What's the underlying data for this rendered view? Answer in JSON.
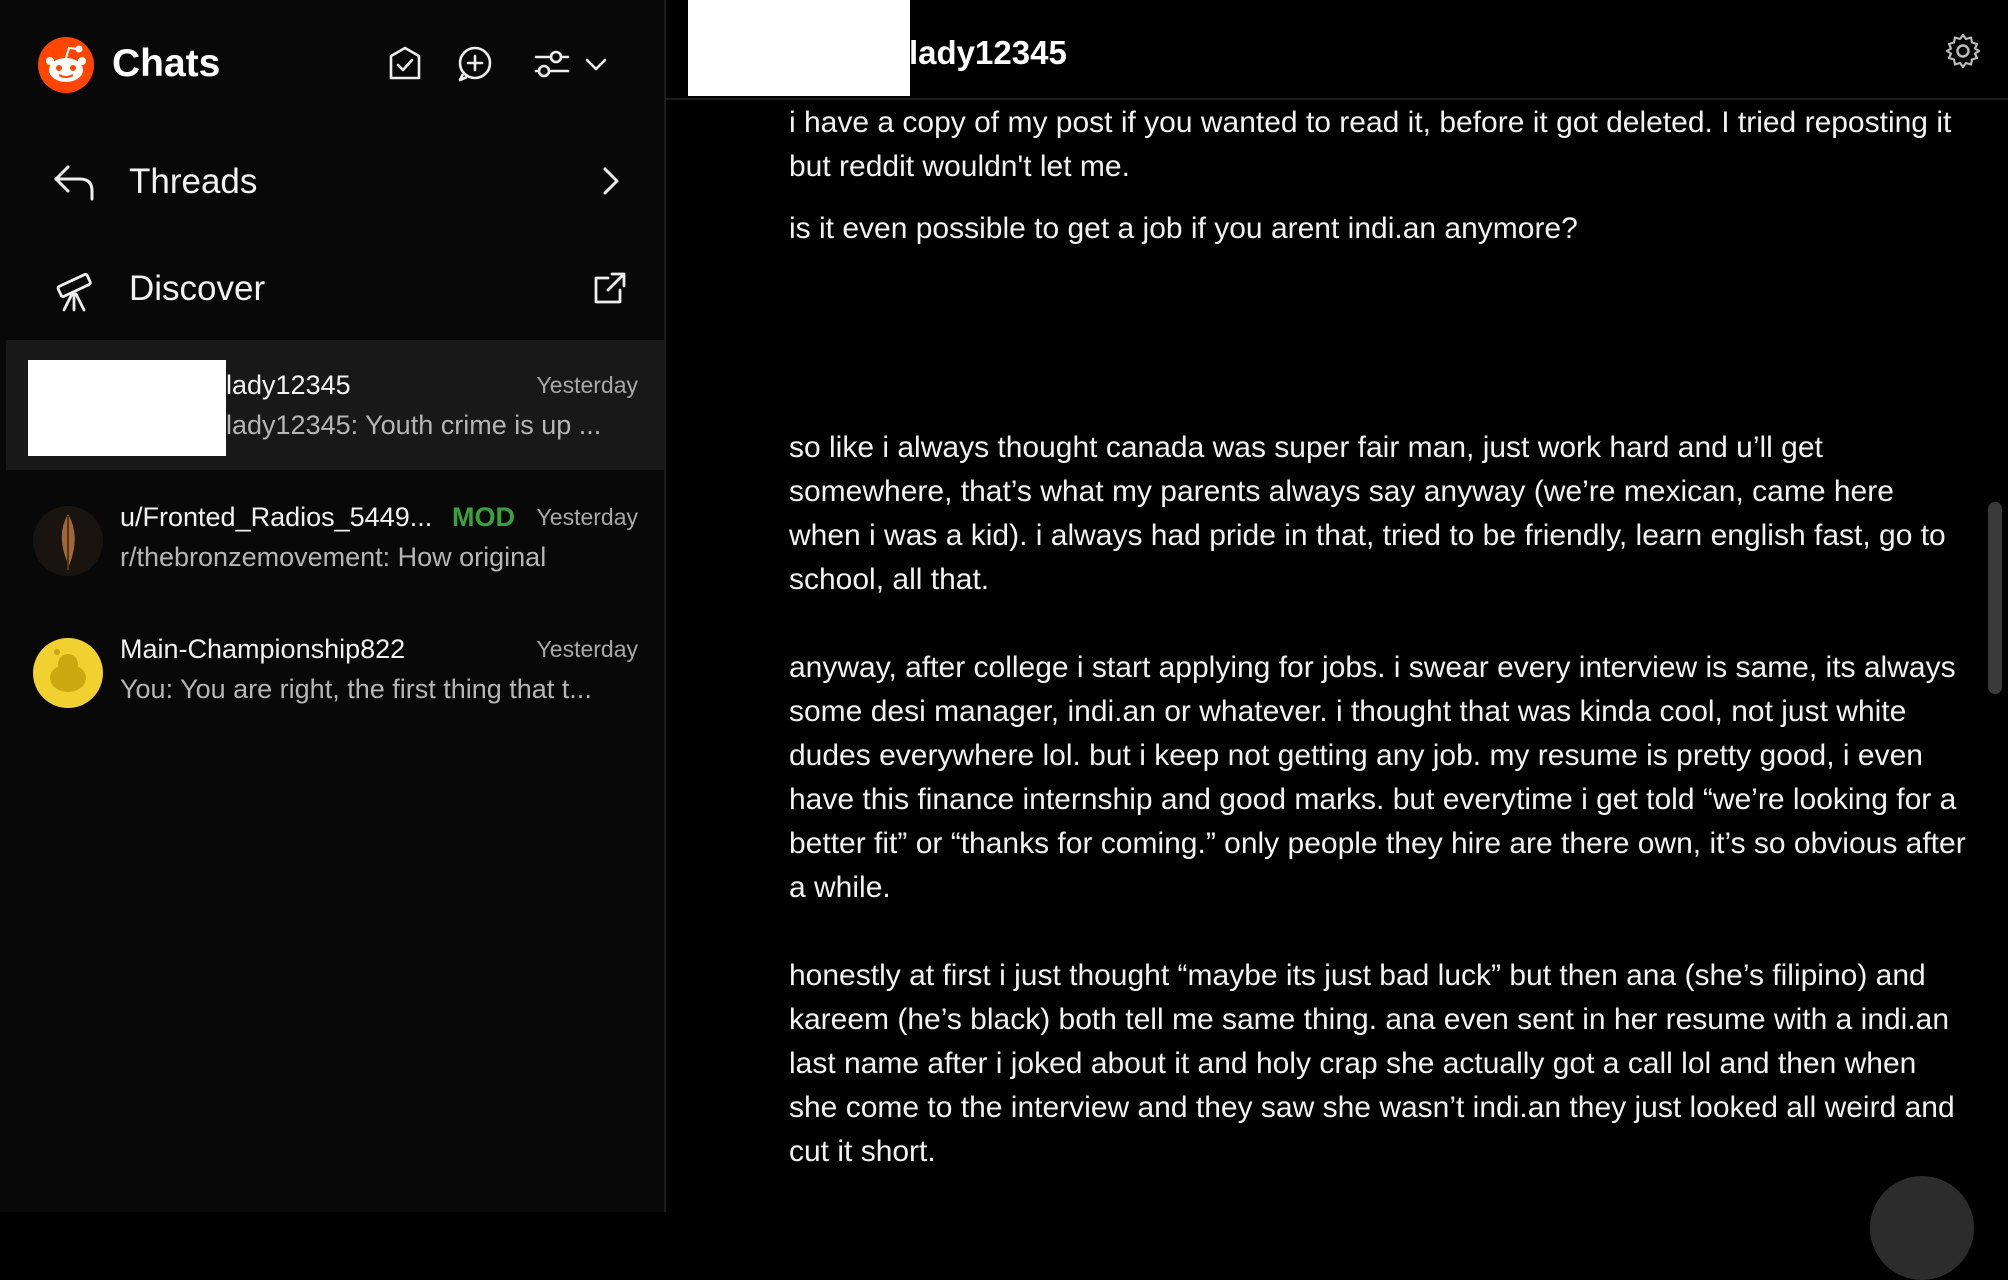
{
  "sidebar": {
    "title": "Chats",
    "icons": [
      "mark-read-icon",
      "new-chat-icon",
      "filter-icon",
      "chevron-down-icon"
    ],
    "nav": [
      {
        "label": "Threads",
        "icon": "reply-arrow-icon",
        "trail": "chevron-right-icon"
      },
      {
        "label": "Discover",
        "icon": "telescope-icon",
        "trail": "external-link-icon"
      }
    ],
    "chats": [
      {
        "name": "lady12345",
        "time": "Yesterday",
        "preview": "lady12345: Youth crime is up ...",
        "active": true
      },
      {
        "name": "u/Fronted_Radios_5449...",
        "badge": "MOD",
        "time": "Yesterday",
        "preview": "r/thebronzemovement: How original"
      },
      {
        "name": "Main-Championship822",
        "time": "Yesterday",
        "preview": "You: You are right, the first thing that t..."
      }
    ]
  },
  "main": {
    "title": "lady12345",
    "messages": [
      "i have a copy of my post if you wanted to read it, before it got deleted. I tried reposting it but reddit wouldn't let me.",
      "is it even possible to get a job if you arent indi.an anymore?",
      "so like i always thought canada was super fair man, just work hard and u’ll get somewhere, that’s what my parents always say anyway (we’re mexican, came here when i was a kid). i always had pride in that, tried to be friendly, learn english fast, go to school, all that.",
      "anyway, after college i start applying for jobs. i swear every interview is same, its always some desi manager, indi.an or whatever. i thought that was kinda cool, not just white dudes everywhere lol. but i keep not getting any job. my resume is pretty good, i even have this finance internship and good marks. but everytime i get told “we’re looking for a better fit” or “thanks for coming.” only people they hire are there own, it’s so obvious after a while.",
      "honestly at first i just thought “maybe its just bad luck” but then ana (she’s filipino) and kareem (he’s black) both tell me same thing. ana even sent in her resume with a indi.an last name after i joked about it and holy crap she actually got a call lol and then when she come to the interview and they saw she wasn’t indi.an they just looked all weird and cut it short."
    ],
    "settings_icon": "gear-icon"
  },
  "colors": {
    "background": "#000000",
    "sidebar": "#080808",
    "active_row": "#181818",
    "brand": "#ff4500",
    "mod_badge": "#3aa23a"
  }
}
